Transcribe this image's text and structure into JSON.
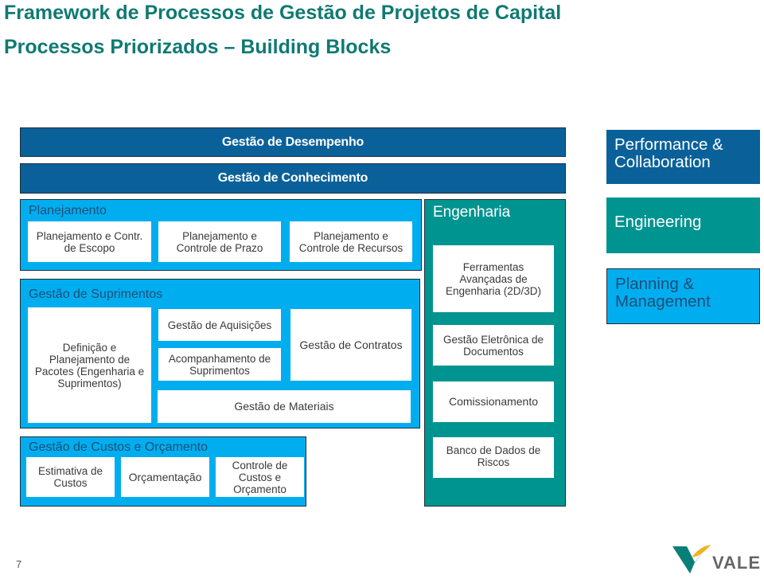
{
  "slide": {
    "title": "Framework de Processos de Gestão de Projetos de Capital",
    "subtitle": "Processos Priorizados – Building Blocks",
    "page_number": "7",
    "logo_text": "VALE"
  },
  "colors": {
    "title_teal": "#0f7a72",
    "performance_collaboration": "#0a6199",
    "engineering": "#009490",
    "planning_management": "#00aeef"
  },
  "bars": [
    {
      "label": "Gestão de Desempenho",
      "category": "Performance & Collaboration"
    },
    {
      "label": "Gestão de Conhecimento",
      "category": "Performance & Collaboration"
    }
  ],
  "groups": {
    "planejamento": {
      "label": "Planejamento",
      "category": "Planning & Management",
      "items": [
        "Planejamento e Contr. de Escopo",
        "Planejamento  e Controle de Prazo",
        "Planejamento e Controle de Recursos"
      ]
    },
    "suprimentos": {
      "label": "Gestão de Suprimentos",
      "category": "Planning & Management",
      "items": [
        "Definição e Planejamento de Pacotes (Engenharia e Suprimentos)",
        "Gestão de Aquisições",
        "Acompanhamento de Suprimentos",
        "Gestão de Contratos",
        "Gestão de Materiais"
      ]
    },
    "engenharia": {
      "label": "Engenharia",
      "category": "Engineering",
      "items": [
        "Ferramentas Avançadas de Engenharia (2D/3D)",
        "Gestão Eletrônica de Documentos",
        "Comissionamento",
        "Banco de Dados de Riscos"
      ]
    },
    "custos": {
      "label": "Gestão de Custos  e Orçamento",
      "category": "Planning & Management",
      "items": [
        "Estimativa de Custos",
        "Orçamentação",
        "Controle de Custos e Orçamento"
      ]
    }
  },
  "legend": [
    {
      "label": "Performance & Collaboration",
      "color": "#0a6199"
    },
    {
      "label": "Engineering",
      "color": "#009490"
    },
    {
      "label": "Planning & Management",
      "color": "#00aeef"
    }
  ]
}
